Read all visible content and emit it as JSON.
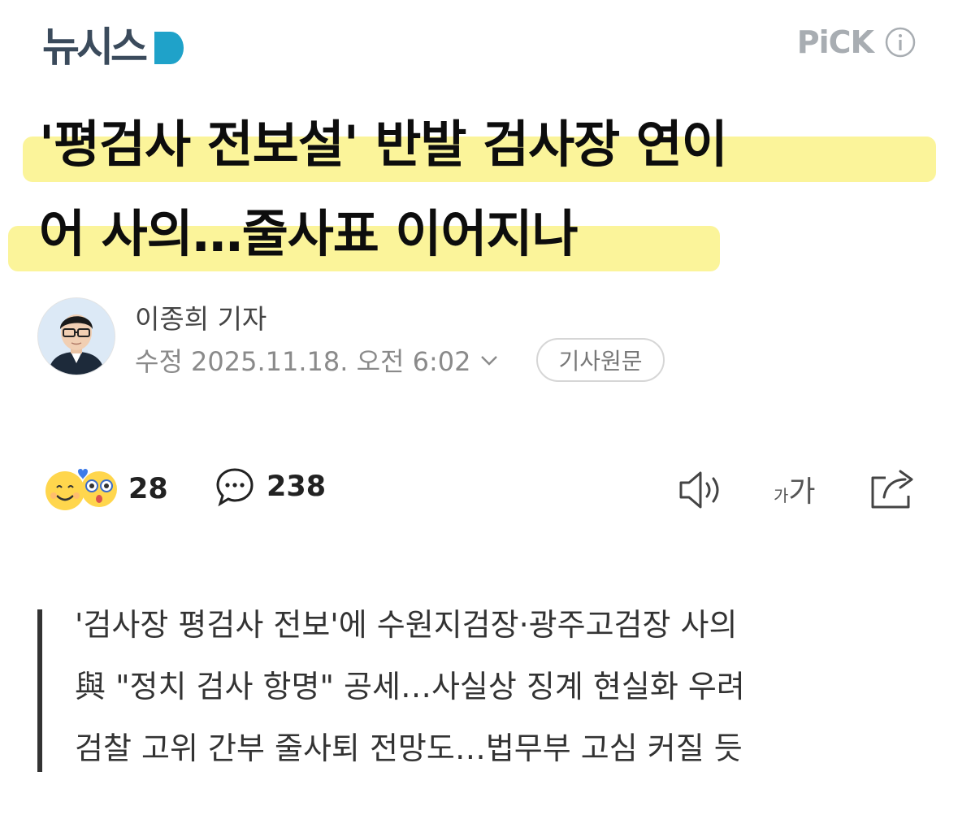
{
  "header": {
    "logo_text": "뉴시스",
    "pick_label": "PiCK",
    "logo_color": "#3b4b5c",
    "logo_accent_color": "#1fa2c9",
    "pick_icon": "info-icon"
  },
  "headline": {
    "line1": "'평검사 전보설' 반발 검사장 연이",
    "line2": "어 사의…줄사표 이어지나",
    "highlight_color": "#fbf49a"
  },
  "byline": {
    "reporter": "이종희 기자",
    "date": "수정 2025.11.18. 오전 6:02",
    "original_button": "기사원문"
  },
  "actions": {
    "reaction_count": "28",
    "comment_count": "238",
    "font_size_small": "가",
    "font_size_large": "가",
    "icons": [
      "reaction-emoji-icon",
      "comment-icon",
      "speaker-icon",
      "share-icon"
    ]
  },
  "summary": {
    "lines": [
      "'검사장 평검사 전보'에 수원지검장·광주고검장 사의",
      "與 \"정치 검사 항명\" 공세…사실상 징계 현실화 우려",
      "검찰 고위 간부 줄사퇴 전망도…법무부 고심 커질 듯"
    ]
  }
}
